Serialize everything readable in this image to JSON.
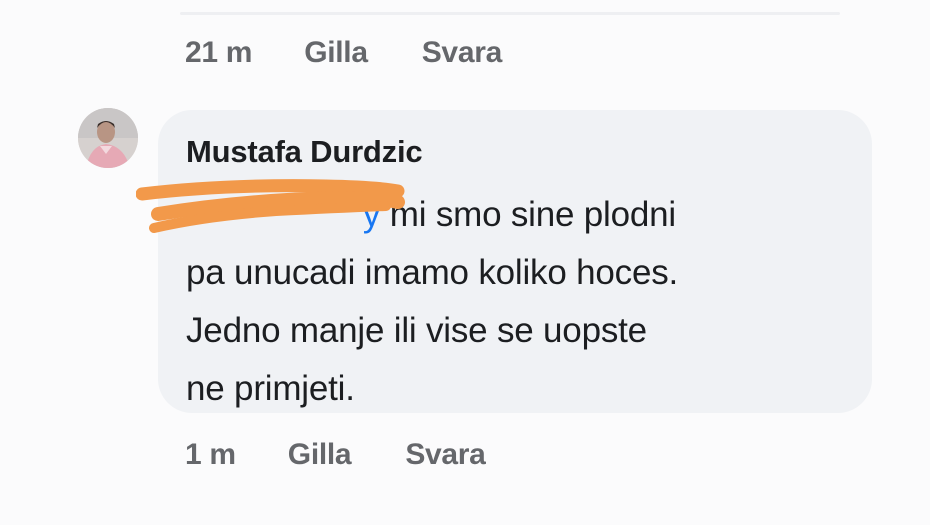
{
  "previous_comment": {
    "time": "21 m",
    "like_label": "Gilla",
    "reply_label": "Svara"
  },
  "comment": {
    "author": "Mustafa Durdzic",
    "mention_visible": "y",
    "line1": " mi smo sine plodni",
    "line2": "pa unucadi imamo koliko hoces.",
    "line3": "Jedno manje ili vise se uopste",
    "line4": "ne primjeti.",
    "time": "1 m",
    "like_label": "Gilla",
    "reply_label": "Svara"
  },
  "colors": {
    "bubble": "#f0f2f5",
    "meta_text": "#65676b",
    "mention": "#1877f2",
    "redaction": "#f2994a"
  },
  "icons": {
    "avatar": "user-profile-photo"
  }
}
